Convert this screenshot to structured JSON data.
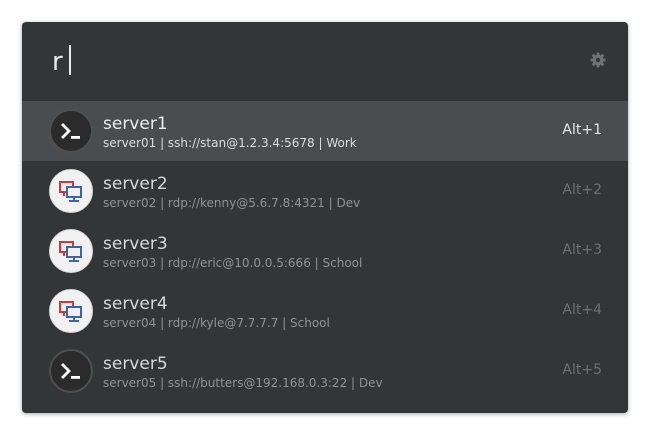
{
  "search": {
    "query": "r"
  },
  "settings_icon": "gear-icon",
  "results": [
    {
      "name": "server1",
      "description": "server01 | ssh://stan@1.2.3.4:5678  | Work",
      "shortcut": "Alt+1",
      "icon": "terminal-icon",
      "selected": true
    },
    {
      "name": "server2",
      "description": "server02 | rdp://kenny@5.6.7.8:4321  | Dev",
      "shortcut": "Alt+2",
      "icon": "remote-desktop-icon",
      "selected": false
    },
    {
      "name": "server3",
      "description": "server03 | rdp://eric@10.0.0.5:666  | School",
      "shortcut": "Alt+3",
      "icon": "remote-desktop-icon",
      "selected": false
    },
    {
      "name": "server4",
      "description": "server04 | rdp://kyle@7.7.7.7  | School",
      "shortcut": "Alt+4",
      "icon": "remote-desktop-icon",
      "selected": false
    },
    {
      "name": "server5",
      "description": "server05 | ssh://butters@192.168.0.3:22  | Dev",
      "shortcut": "Alt+5",
      "icon": "terminal-icon",
      "selected": false
    }
  ],
  "colors": {
    "panel_bg": "#333637",
    "selected_row_bg": "#4a4d4f",
    "rdp_red": "#d0393b",
    "rdp_blue": "#3a66a8"
  }
}
